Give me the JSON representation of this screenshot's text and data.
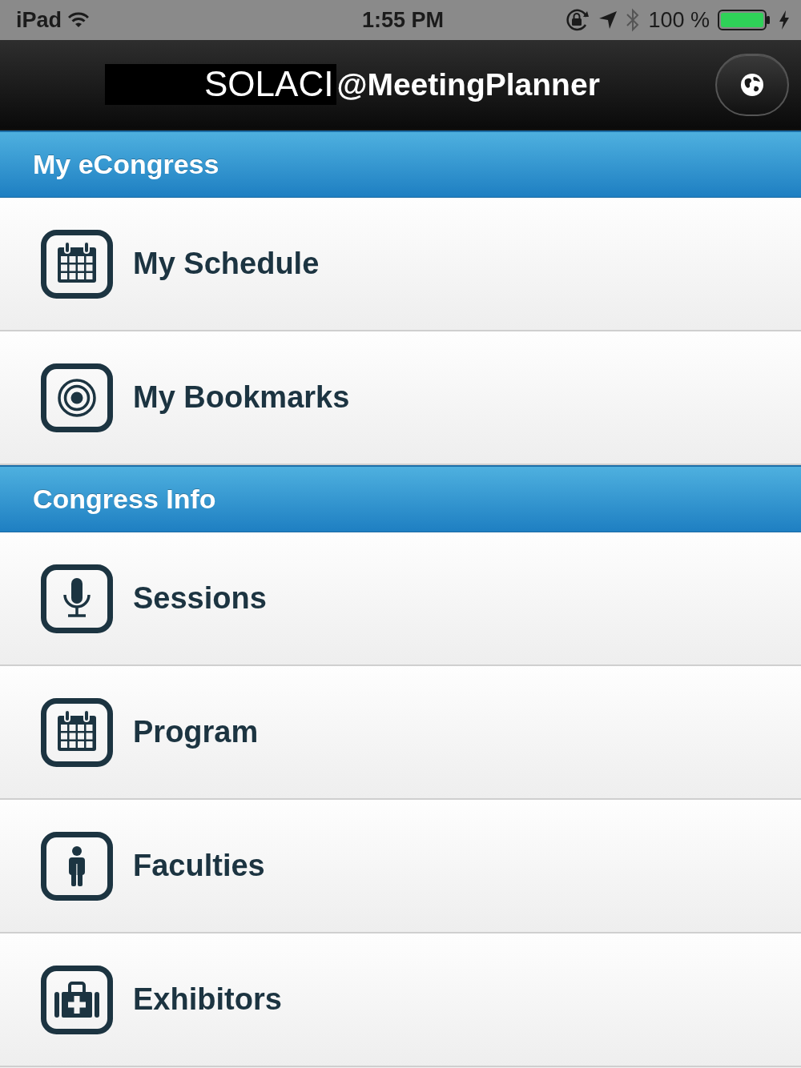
{
  "status_bar": {
    "device": "iPad",
    "time": "1:55 PM",
    "battery": "100 %"
  },
  "header": {
    "title_prefix": "SOLACI",
    "title": "@MeetingPlanner"
  },
  "sections": [
    {
      "title": "My eCongress",
      "items": [
        {
          "label": "My Schedule",
          "kind": "calendar"
        },
        {
          "label": "My Bookmarks",
          "kind": "target"
        }
      ]
    },
    {
      "title": "Congress Info",
      "items": [
        {
          "label": "Sessions",
          "kind": "microphone"
        },
        {
          "label": "Program",
          "kind": "calendar"
        },
        {
          "label": "Faculties",
          "kind": "person"
        },
        {
          "label": "Exhibitors",
          "kind": "medkit"
        }
      ]
    }
  ]
}
